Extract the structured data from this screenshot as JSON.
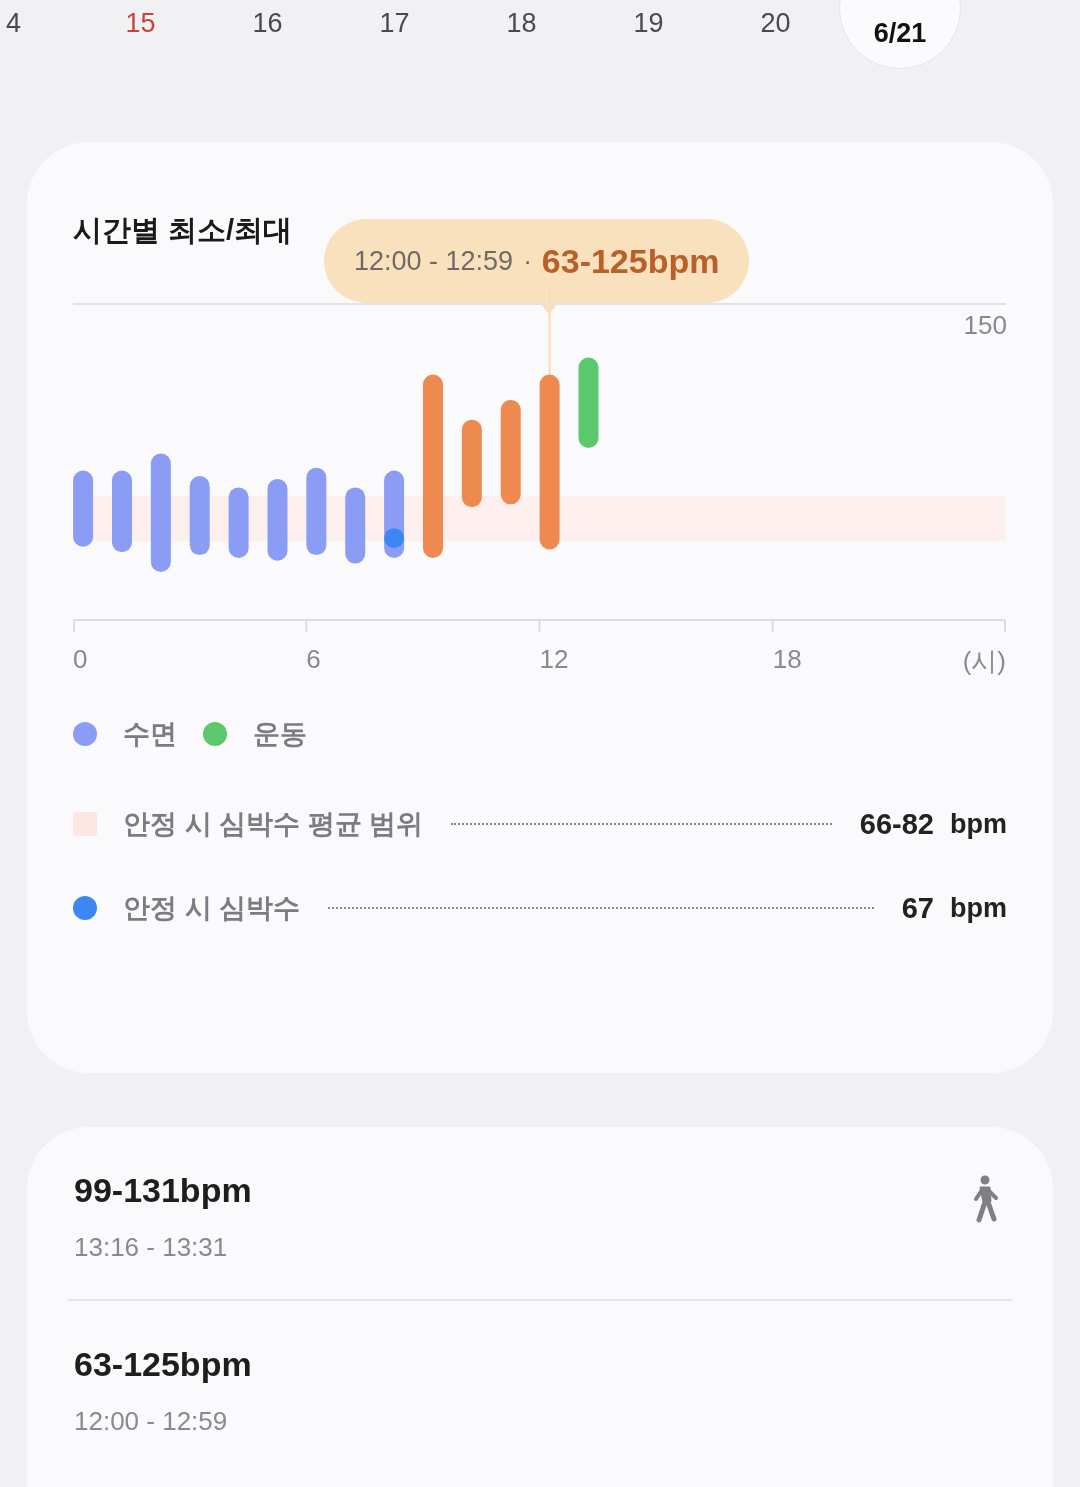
{
  "dates": [
    {
      "label": "4",
      "selected": false,
      "sunday": false
    },
    {
      "label": "15",
      "selected": false,
      "sunday": true
    },
    {
      "label": "16",
      "selected": false,
      "sunday": false
    },
    {
      "label": "17",
      "selected": false,
      "sunday": false
    },
    {
      "label": "18",
      "selected": false,
      "sunday": false
    },
    {
      "label": "19",
      "selected": false,
      "sunday": false
    },
    {
      "label": "20",
      "selected": false,
      "sunday": false
    },
    {
      "label": "6/21",
      "selected": true,
      "sunday": false
    }
  ],
  "chart_card": {
    "title": "시간별 최소/최대",
    "tooltip": {
      "time": "12:00 - 12:59",
      "separator": "·",
      "value": "63-125bpm"
    },
    "chart": {
      "y_label": "150",
      "x_labels": [
        "0",
        "6",
        "12",
        "18",
        "(시)"
      ]
    },
    "legend": [
      {
        "label": "수면",
        "color": "#8b9cf5"
      },
      {
        "label": "운동",
        "color": "#5bc86e"
      }
    ],
    "stats": [
      {
        "kind": "square",
        "color": "#fce6e1",
        "label": "안정 시 심박수 평균 범위",
        "value": "66-82",
        "unit": "bpm"
      },
      {
        "kind": "dot",
        "color": "#3f86f5",
        "label": "안정 시 심박수",
        "value": "67",
        "unit": "bpm"
      }
    ]
  },
  "records": [
    {
      "value": "99-131bpm",
      "time": "13:16 - 13:31",
      "kind": "exercise"
    },
    {
      "value": "63-125bpm",
      "time": "12:00 - 12:59",
      "kind": "plain"
    }
  ]
}
